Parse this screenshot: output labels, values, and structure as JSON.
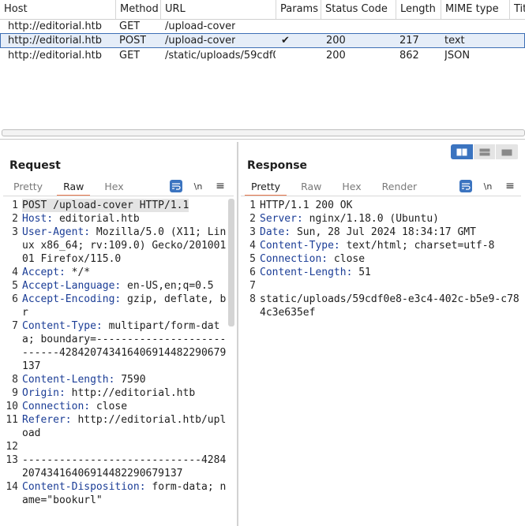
{
  "table": {
    "columns": [
      "Host",
      "Method",
      "URL",
      "Params",
      "Status Code",
      "Length",
      "MIME type",
      "Title"
    ],
    "rows": [
      {
        "host": "http://editorial.htb",
        "method": "GET",
        "url": "/upload-cover",
        "params": "",
        "status": "",
        "length": "",
        "mime": "",
        "selected": false
      },
      {
        "host": "http://editorial.htb",
        "method": "POST",
        "url": "/upload-cover",
        "params": "✔",
        "status": "200",
        "length": "217",
        "mime": "text",
        "selected": true
      },
      {
        "host": "http://editorial.htb",
        "method": "GET",
        "url": "/static/uploads/59cdf0...",
        "params": "",
        "status": "200",
        "length": "862",
        "mime": "JSON",
        "selected": false
      }
    ]
  },
  "request": {
    "title": "Request",
    "tabs": [
      "Pretty",
      "Raw",
      "Hex"
    ],
    "active_tab": "Raw",
    "newline_label": "\\n",
    "lines": [
      {
        "n": "1",
        "key": "",
        "val": "POST /upload-cover HTTP/1.1",
        "highlight": true
      },
      {
        "n": "2",
        "key": "Host:",
        "val": " editorial.htb"
      },
      {
        "n": "3",
        "key": "User-Agent:",
        "val": " Mozilla/5.0 (X11; Linux x86_64; rv:109.0) Gecko/20100101 Firefox/115.0"
      },
      {
        "n": "4",
        "key": "Accept:",
        "val": " */*"
      },
      {
        "n": "5",
        "key": "Accept-Language:",
        "val": " en-US,en;q=0.5"
      },
      {
        "n": "6",
        "key": "Accept-Encoding:",
        "val": " gzip, deflate, br"
      },
      {
        "n": "7",
        "key": "Content-Type:",
        "val": " multipart/form-data; boundary=---------------------------428420743416406914482290679137"
      },
      {
        "n": "8",
        "key": "Content-Length:",
        "val": " 7590"
      },
      {
        "n": "9",
        "key": "Origin:",
        "val": " http://editorial.htb"
      },
      {
        "n": "10",
        "key": "Connection:",
        "val": " close"
      },
      {
        "n": "11",
        "key": "Referer:",
        "val": " http://editorial.htb/upload"
      },
      {
        "n": "12",
        "key": "",
        "val": ""
      },
      {
        "n": "13",
        "key": "",
        "val": "-----------------------------428420743416406914482290679137"
      },
      {
        "n": "14",
        "key": "Content-Disposition:",
        "val": " form-data; name=\"bookurl\""
      }
    ]
  },
  "response": {
    "title": "Response",
    "tabs": [
      "Pretty",
      "Raw",
      "Hex",
      "Render"
    ],
    "active_tab": "Pretty",
    "newline_label": "\\n",
    "lines": [
      {
        "n": "1",
        "key": "",
        "val": "HTTP/1.1 200 OK"
      },
      {
        "n": "2",
        "key": "Server:",
        "val": " nginx/1.18.0 (Ubuntu)"
      },
      {
        "n": "3",
        "key": "Date:",
        "val": " Sun, 28 Jul 2024 18:34:17 GMT"
      },
      {
        "n": "4",
        "key": "Content-Type:",
        "val": " text/html; charset=utf-8"
      },
      {
        "n": "5",
        "key": "Connection:",
        "val": " close"
      },
      {
        "n": "6",
        "key": "Content-Length:",
        "val": " 51"
      },
      {
        "n": "7",
        "key": "",
        "val": ""
      },
      {
        "n": "8",
        "key": "",
        "val": "static/uploads/59cdf0e8-e3c4-402c-b5e9-c784c3e635ef"
      }
    ]
  },
  "colors": {
    "accent": "#3b74c0",
    "tab_underline": "#e8764d",
    "header_key": "#1b3d96",
    "selected_row": "#e5edf8"
  }
}
